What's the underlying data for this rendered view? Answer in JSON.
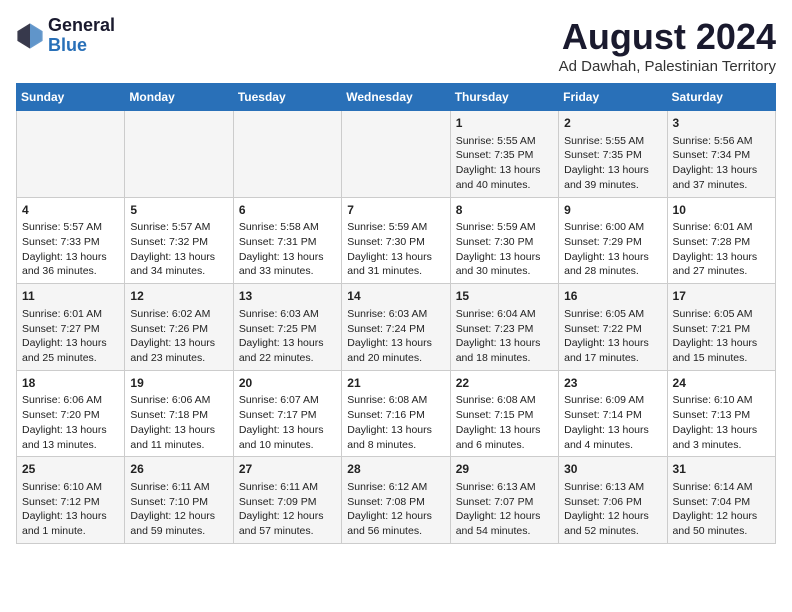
{
  "header": {
    "logo_general": "General",
    "logo_blue": "Blue",
    "month_year": "August 2024",
    "subtitle": "Ad Dawhah, Palestinian Territory"
  },
  "days_of_week": [
    "Sunday",
    "Monday",
    "Tuesday",
    "Wednesday",
    "Thursday",
    "Friday",
    "Saturday"
  ],
  "weeks": [
    [
      {
        "day": "",
        "info": ""
      },
      {
        "day": "",
        "info": ""
      },
      {
        "day": "",
        "info": ""
      },
      {
        "day": "",
        "info": ""
      },
      {
        "day": "1",
        "info": "Sunrise: 5:55 AM\nSunset: 7:35 PM\nDaylight: 13 hours\nand 40 minutes."
      },
      {
        "day": "2",
        "info": "Sunrise: 5:55 AM\nSunset: 7:35 PM\nDaylight: 13 hours\nand 39 minutes."
      },
      {
        "day": "3",
        "info": "Sunrise: 5:56 AM\nSunset: 7:34 PM\nDaylight: 13 hours\nand 37 minutes."
      }
    ],
    [
      {
        "day": "4",
        "info": "Sunrise: 5:57 AM\nSunset: 7:33 PM\nDaylight: 13 hours\nand 36 minutes."
      },
      {
        "day": "5",
        "info": "Sunrise: 5:57 AM\nSunset: 7:32 PM\nDaylight: 13 hours\nand 34 minutes."
      },
      {
        "day": "6",
        "info": "Sunrise: 5:58 AM\nSunset: 7:31 PM\nDaylight: 13 hours\nand 33 minutes."
      },
      {
        "day": "7",
        "info": "Sunrise: 5:59 AM\nSunset: 7:30 PM\nDaylight: 13 hours\nand 31 minutes."
      },
      {
        "day": "8",
        "info": "Sunrise: 5:59 AM\nSunset: 7:30 PM\nDaylight: 13 hours\nand 30 minutes."
      },
      {
        "day": "9",
        "info": "Sunrise: 6:00 AM\nSunset: 7:29 PM\nDaylight: 13 hours\nand 28 minutes."
      },
      {
        "day": "10",
        "info": "Sunrise: 6:01 AM\nSunset: 7:28 PM\nDaylight: 13 hours\nand 27 minutes."
      }
    ],
    [
      {
        "day": "11",
        "info": "Sunrise: 6:01 AM\nSunset: 7:27 PM\nDaylight: 13 hours\nand 25 minutes."
      },
      {
        "day": "12",
        "info": "Sunrise: 6:02 AM\nSunset: 7:26 PM\nDaylight: 13 hours\nand 23 minutes."
      },
      {
        "day": "13",
        "info": "Sunrise: 6:03 AM\nSunset: 7:25 PM\nDaylight: 13 hours\nand 22 minutes."
      },
      {
        "day": "14",
        "info": "Sunrise: 6:03 AM\nSunset: 7:24 PM\nDaylight: 13 hours\nand 20 minutes."
      },
      {
        "day": "15",
        "info": "Sunrise: 6:04 AM\nSunset: 7:23 PM\nDaylight: 13 hours\nand 18 minutes."
      },
      {
        "day": "16",
        "info": "Sunrise: 6:05 AM\nSunset: 7:22 PM\nDaylight: 13 hours\nand 17 minutes."
      },
      {
        "day": "17",
        "info": "Sunrise: 6:05 AM\nSunset: 7:21 PM\nDaylight: 13 hours\nand 15 minutes."
      }
    ],
    [
      {
        "day": "18",
        "info": "Sunrise: 6:06 AM\nSunset: 7:20 PM\nDaylight: 13 hours\nand 13 minutes."
      },
      {
        "day": "19",
        "info": "Sunrise: 6:06 AM\nSunset: 7:18 PM\nDaylight: 13 hours\nand 11 minutes."
      },
      {
        "day": "20",
        "info": "Sunrise: 6:07 AM\nSunset: 7:17 PM\nDaylight: 13 hours\nand 10 minutes."
      },
      {
        "day": "21",
        "info": "Sunrise: 6:08 AM\nSunset: 7:16 PM\nDaylight: 13 hours\nand 8 minutes."
      },
      {
        "day": "22",
        "info": "Sunrise: 6:08 AM\nSunset: 7:15 PM\nDaylight: 13 hours\nand 6 minutes."
      },
      {
        "day": "23",
        "info": "Sunrise: 6:09 AM\nSunset: 7:14 PM\nDaylight: 13 hours\nand 4 minutes."
      },
      {
        "day": "24",
        "info": "Sunrise: 6:10 AM\nSunset: 7:13 PM\nDaylight: 13 hours\nand 3 minutes."
      }
    ],
    [
      {
        "day": "25",
        "info": "Sunrise: 6:10 AM\nSunset: 7:12 PM\nDaylight: 13 hours\nand 1 minute."
      },
      {
        "day": "26",
        "info": "Sunrise: 6:11 AM\nSunset: 7:10 PM\nDaylight: 12 hours\nand 59 minutes."
      },
      {
        "day": "27",
        "info": "Sunrise: 6:11 AM\nSunset: 7:09 PM\nDaylight: 12 hours\nand 57 minutes."
      },
      {
        "day": "28",
        "info": "Sunrise: 6:12 AM\nSunset: 7:08 PM\nDaylight: 12 hours\nand 56 minutes."
      },
      {
        "day": "29",
        "info": "Sunrise: 6:13 AM\nSunset: 7:07 PM\nDaylight: 12 hours\nand 54 minutes."
      },
      {
        "day": "30",
        "info": "Sunrise: 6:13 AM\nSunset: 7:06 PM\nDaylight: 12 hours\nand 52 minutes."
      },
      {
        "day": "31",
        "info": "Sunrise: 6:14 AM\nSunset: 7:04 PM\nDaylight: 12 hours\nand 50 minutes."
      }
    ]
  ]
}
